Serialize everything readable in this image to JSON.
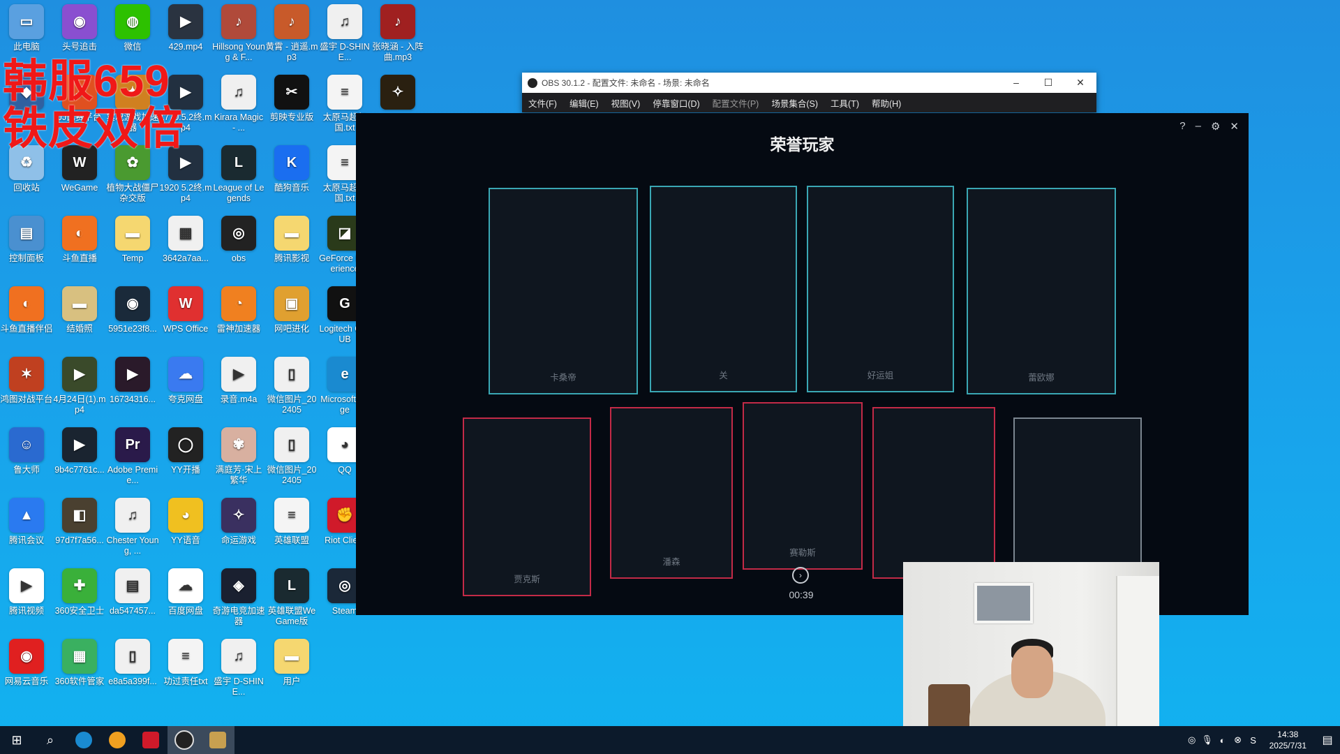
{
  "overlay": {
    "line1": "韩服659",
    "line2": "铁皮双倍"
  },
  "desktop_icons": [
    {
      "label": "此电脑",
      "icon": "computer-icon",
      "color": "#5aa0e0",
      "glyph": "▭"
    },
    {
      "label": "头号追击",
      "icon": "game-logo-icon",
      "color": "#8a4fd0",
      "glyph": "◉"
    },
    {
      "label": "微信",
      "icon": "wechat-icon",
      "color": "#2dc100",
      "glyph": "◍"
    },
    {
      "label": "429.mp4",
      "icon": "video-file-icon",
      "color": "#2a3340",
      "glyph": "▶"
    },
    {
      "label": "Hillsong Young & F...",
      "icon": "music-file-icon",
      "color": "#b04a3a",
      "glyph": "♪"
    },
    {
      "label": "黄霄 - 逍遥.mp3",
      "icon": "music-file-icon",
      "color": "#c85a2a",
      "glyph": "♪"
    },
    {
      "label": "盛宇 D-SHINE...",
      "icon": "kgm-file-icon",
      "color": "#f0f0f0",
      "glyph": "♫"
    },
    {
      "label": "张晓涵 - 入阵曲.mp3",
      "icon": "music-file-icon",
      "color": "#a02020",
      "glyph": "♪"
    },
    {
      "label": "",
      "icon": "app-icon",
      "color": "#3060a0",
      "glyph": "◆"
    },
    {
      "label": "JJ比赛平台",
      "icon": "game-logo-icon",
      "color": "#e05020",
      "glyph": "J"
    },
    {
      "label": "实况游戏加速器",
      "icon": "app-icon",
      "color": "#d08020",
      "glyph": "✦"
    },
    {
      "label": "1770.5.2终.mp4",
      "icon": "video-file-icon",
      "color": "#223040",
      "glyph": "▶"
    },
    {
      "label": "Kirara Magic - ...",
      "icon": "mp3-file-icon",
      "color": "#f0f0f0",
      "glyph": "♫"
    },
    {
      "label": "剪映专业版",
      "icon": "capcut-icon",
      "color": "#111",
      "glyph": "✂"
    },
    {
      "label": "太原马超起国.txt",
      "icon": "text-file-icon",
      "color": "#f4f4f4",
      "glyph": "≡"
    },
    {
      "label": "",
      "icon": "image-file-icon",
      "color": "#2a2010",
      "glyph": "✧"
    },
    {
      "label": "回收站",
      "icon": "recycle-bin-icon",
      "color": "#8fc0e8",
      "glyph": "♻"
    },
    {
      "label": "WeGame",
      "icon": "wegame-icon",
      "color": "#222",
      "glyph": "W"
    },
    {
      "label": "植物大战僵尸杂交版",
      "icon": "game-logo-icon",
      "color": "#4a9a30",
      "glyph": "✿"
    },
    {
      "label": "1920 5.2终.mp4",
      "icon": "video-file-icon",
      "color": "#223040",
      "glyph": "▶"
    },
    {
      "label": "League of Legends",
      "icon": "lol-icon",
      "color": "#1a2a30",
      "glyph": "L"
    },
    {
      "label": "酷狗音乐",
      "icon": "kugou-icon",
      "color": "#1a6ef0",
      "glyph": "K"
    },
    {
      "label": "太原马超起国.txt",
      "icon": "text-file-icon",
      "color": "#f4f4f4",
      "glyph": "≡"
    },
    {
      "label": "控制面板",
      "icon": "control-panel-icon",
      "color": "#4a90d0",
      "glyph": "▤"
    },
    {
      "label": "斗鱼直播",
      "icon": "douyu-icon",
      "color": "#f07020",
      "glyph": "◐"
    },
    {
      "label": "Temp",
      "icon": "folder-icon",
      "color": "#f5d770",
      "glyph": "▬"
    },
    {
      "label": "3642a7aa...",
      "icon": "qr-file-icon",
      "color": "#f0f0f0",
      "glyph": "▦"
    },
    {
      "label": "obs",
      "icon": "obs-icon",
      "color": "#222",
      "glyph": "◎"
    },
    {
      "label": "腾讯影视",
      "icon": "folder-icon",
      "color": "#f5d770",
      "glyph": "▬"
    },
    {
      "label": "GeForce Experience",
      "icon": "nvidia-icon",
      "color": "#2a3a1a",
      "glyph": "◪"
    },
    {
      "label": "斗鱼直播伴侣",
      "icon": "douyu-icon",
      "color": "#f07020",
      "glyph": "◐"
    },
    {
      "label": "结婚照",
      "icon": "folder-icon",
      "color": "#d8c080",
      "glyph": "▬"
    },
    {
      "label": "5951e23f8...",
      "icon": "image-file-icon",
      "color": "#1a2a3a",
      "glyph": "◉"
    },
    {
      "label": "WPS Office",
      "icon": "wps-icon",
      "color": "#e03030",
      "glyph": "W"
    },
    {
      "label": "雷神加速器",
      "icon": "app-icon",
      "color": "#f08020",
      "glyph": "◔"
    },
    {
      "label": "网吧进化",
      "icon": "app-icon",
      "color": "#e0a030",
      "glyph": "▣"
    },
    {
      "label": "Logitech G HUB",
      "icon": "logitech-icon",
      "color": "#111",
      "glyph": "G"
    },
    {
      "label": "鸿图对战平台",
      "icon": "game-logo-icon",
      "color": "#c04020",
      "glyph": "✶"
    },
    {
      "label": "4月24日(1).mp4",
      "icon": "video-file-icon",
      "color": "#3a4a2a",
      "glyph": "▶"
    },
    {
      "label": "16734316...",
      "icon": "video-file-icon",
      "color": "#2a1a2a",
      "glyph": "▶"
    },
    {
      "label": "夸克网盘",
      "icon": "cloud-icon",
      "color": "#3a7af0",
      "glyph": "☁"
    },
    {
      "label": "录音.m4a",
      "icon": "audio-file-icon",
      "color": "#f0f0f0",
      "glyph": "▶"
    },
    {
      "label": "微信图片_202405",
      "icon": "image-file-icon",
      "color": "#f0f0f0",
      "glyph": "▯"
    },
    {
      "label": "Microsoft Edge",
      "icon": "edge-icon",
      "color": "#1a8ad0",
      "glyph": "e"
    },
    {
      "label": "鲁大师",
      "icon": "app-icon",
      "color": "#2a6ad0",
      "glyph": "☺"
    },
    {
      "label": "9b4c7761c...",
      "icon": "video-file-icon",
      "color": "#1a2430",
      "glyph": "▶"
    },
    {
      "label": "Adobe Premie...",
      "icon": "premiere-icon",
      "color": "#2a1a4a",
      "glyph": "Pr"
    },
    {
      "label": "YY开播",
      "icon": "app-icon",
      "color": "#222",
      "glyph": "◯"
    },
    {
      "label": "满庭芳·宋上繁华",
      "icon": "game-logo-icon",
      "color": "#d8b0a0",
      "glyph": "✾"
    },
    {
      "label": "微信图片_202405",
      "icon": "image-file-icon",
      "color": "#f0f0f0",
      "glyph": "▯"
    },
    {
      "label": "QQ",
      "icon": "qq-icon",
      "color": "#fff",
      "glyph": "◕"
    },
    {
      "label": "腾讯会议",
      "icon": "tencent-meeting-icon",
      "color": "#2a7af0",
      "glyph": "▲"
    },
    {
      "label": "97d7f7a56...",
      "icon": "image-file-icon",
      "color": "#4a4030",
      "glyph": "◧"
    },
    {
      "label": "Chester Young, ...",
      "icon": "flac-file-icon",
      "color": "#f0f0f0",
      "glyph": "♫"
    },
    {
      "label": "YY语音",
      "icon": "app-icon",
      "color": "#f0c020",
      "glyph": "◕"
    },
    {
      "label": "命运游戏",
      "icon": "game-logo-icon",
      "color": "#3a3060",
      "glyph": "✧"
    },
    {
      "label": "英雄联盟",
      "icon": "text-file-icon",
      "color": "#f4f4f4",
      "glyph": "≡"
    },
    {
      "label": "Riot Client",
      "icon": "riot-icon",
      "color": "#d01a2a",
      "glyph": "✊"
    },
    {
      "label": "腾讯视频",
      "icon": "tencent-video-icon",
      "color": "#fff",
      "glyph": "▶"
    },
    {
      "label": "360安全卫士",
      "icon": "360-icon",
      "color": "#3ab03a",
      "glyph": "✚"
    },
    {
      "label": "da547457...",
      "icon": "image-file-icon",
      "color": "#f0f0f0",
      "glyph": "▤"
    },
    {
      "label": "百度网盘",
      "icon": "baidu-pan-icon",
      "color": "#fff",
      "glyph": "☁"
    },
    {
      "label": "奇游电竞加速器",
      "icon": "app-icon",
      "color": "#1a2030",
      "glyph": "◈"
    },
    {
      "label": "英雄联盟WeGame版",
      "icon": "lol-icon",
      "color": "#1a2a30",
      "glyph": "L"
    },
    {
      "label": "Steam",
      "icon": "steam-icon",
      "color": "#1b2838",
      "glyph": "◎"
    },
    {
      "label": "网易云音乐",
      "icon": "netease-music-icon",
      "color": "#e02020",
      "glyph": "◉"
    },
    {
      "label": "360软件管家",
      "icon": "360-icon",
      "color": "#3ab060",
      "glyph": "▦"
    },
    {
      "label": "e8a5a399f...",
      "icon": "image-file-icon",
      "color": "#f0f0f0",
      "glyph": "▯"
    },
    {
      "label": "功过责任txt",
      "icon": "text-file-icon",
      "color": "#f4f4f4",
      "glyph": "≡"
    },
    {
      "label": "盛宇 D-SHINE...",
      "icon": "mp3-file-icon",
      "color": "#f0f0f0",
      "glyph": "♫"
    },
    {
      "label": "用户",
      "icon": "folder-icon",
      "color": "#f5d770",
      "glyph": "▬"
    }
  ],
  "obs": {
    "title": "OBS 30.1.2 - 配置文件: 未命名 - 场景: 未命名",
    "menu": [
      "文件(F)",
      "编辑(E)",
      "视图(V)",
      "停靠窗口(D)",
      "配置文件(P)",
      "场景集合(S)",
      "工具(T)",
      "帮助(H)"
    ]
  },
  "game": {
    "title": "荣誉玩家",
    "top_cards": [
      "卡桑帝",
      "关",
      "好运姐",
      "蕾欧娜"
    ],
    "bottom_cards": [
      "贾克斯",
      "潘森",
      "赛勒斯",
      "",
      ""
    ],
    "timer": "00:39",
    "next_glyph": "›",
    "controls": [
      "?",
      "–",
      "⚙",
      "✕"
    ]
  },
  "taskbar": {
    "time": "14:38",
    "date": "2025/7/31"
  }
}
